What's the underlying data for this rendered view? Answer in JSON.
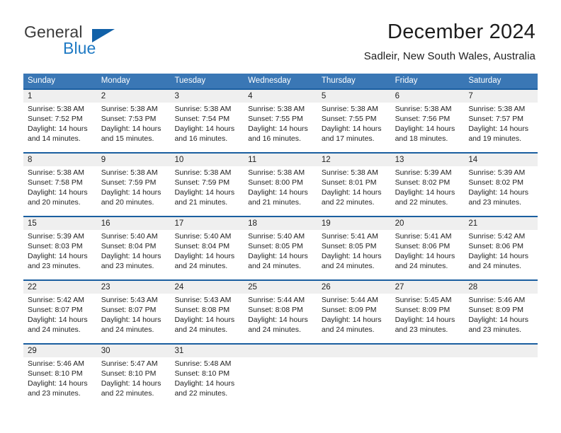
{
  "brand": {
    "name_part1": "General",
    "name_part2": "Blue",
    "triangle_icon": "triangle-icon"
  },
  "header": {
    "title": "December 2024",
    "location": "Sadleir, New South Wales, Australia"
  },
  "colors": {
    "header_blue": "#3a77b5",
    "rule_blue": "#1b5fa0",
    "band_gray": "#efefef",
    "brand_blue": "#1f7ac4",
    "brand_triangle": "#1161a8",
    "text": "#222222"
  },
  "weekdays": [
    "Sunday",
    "Monday",
    "Tuesday",
    "Wednesday",
    "Thursday",
    "Friday",
    "Saturday"
  ],
  "weeks": [
    [
      {
        "day": "1",
        "sunrise": "Sunrise: 5:38 AM",
        "sunset": "Sunset: 7:52 PM",
        "daylight1": "Daylight: 14 hours",
        "daylight2": "and 14 minutes."
      },
      {
        "day": "2",
        "sunrise": "Sunrise: 5:38 AM",
        "sunset": "Sunset: 7:53 PM",
        "daylight1": "Daylight: 14 hours",
        "daylight2": "and 15 minutes."
      },
      {
        "day": "3",
        "sunrise": "Sunrise: 5:38 AM",
        "sunset": "Sunset: 7:54 PM",
        "daylight1": "Daylight: 14 hours",
        "daylight2": "and 16 minutes."
      },
      {
        "day": "4",
        "sunrise": "Sunrise: 5:38 AM",
        "sunset": "Sunset: 7:55 PM",
        "daylight1": "Daylight: 14 hours",
        "daylight2": "and 16 minutes."
      },
      {
        "day": "5",
        "sunrise": "Sunrise: 5:38 AM",
        "sunset": "Sunset: 7:55 PM",
        "daylight1": "Daylight: 14 hours",
        "daylight2": "and 17 minutes."
      },
      {
        "day": "6",
        "sunrise": "Sunrise: 5:38 AM",
        "sunset": "Sunset: 7:56 PM",
        "daylight1": "Daylight: 14 hours",
        "daylight2": "and 18 minutes."
      },
      {
        "day": "7",
        "sunrise": "Sunrise: 5:38 AM",
        "sunset": "Sunset: 7:57 PM",
        "daylight1": "Daylight: 14 hours",
        "daylight2": "and 19 minutes."
      }
    ],
    [
      {
        "day": "8",
        "sunrise": "Sunrise: 5:38 AM",
        "sunset": "Sunset: 7:58 PM",
        "daylight1": "Daylight: 14 hours",
        "daylight2": "and 20 minutes."
      },
      {
        "day": "9",
        "sunrise": "Sunrise: 5:38 AM",
        "sunset": "Sunset: 7:59 PM",
        "daylight1": "Daylight: 14 hours",
        "daylight2": "and 20 minutes."
      },
      {
        "day": "10",
        "sunrise": "Sunrise: 5:38 AM",
        "sunset": "Sunset: 7:59 PM",
        "daylight1": "Daylight: 14 hours",
        "daylight2": "and 21 minutes."
      },
      {
        "day": "11",
        "sunrise": "Sunrise: 5:38 AM",
        "sunset": "Sunset: 8:00 PM",
        "daylight1": "Daylight: 14 hours",
        "daylight2": "and 21 minutes."
      },
      {
        "day": "12",
        "sunrise": "Sunrise: 5:38 AM",
        "sunset": "Sunset: 8:01 PM",
        "daylight1": "Daylight: 14 hours",
        "daylight2": "and 22 minutes."
      },
      {
        "day": "13",
        "sunrise": "Sunrise: 5:39 AM",
        "sunset": "Sunset: 8:02 PM",
        "daylight1": "Daylight: 14 hours",
        "daylight2": "and 22 minutes."
      },
      {
        "day": "14",
        "sunrise": "Sunrise: 5:39 AM",
        "sunset": "Sunset: 8:02 PM",
        "daylight1": "Daylight: 14 hours",
        "daylight2": "and 23 minutes."
      }
    ],
    [
      {
        "day": "15",
        "sunrise": "Sunrise: 5:39 AM",
        "sunset": "Sunset: 8:03 PM",
        "daylight1": "Daylight: 14 hours",
        "daylight2": "and 23 minutes."
      },
      {
        "day": "16",
        "sunrise": "Sunrise: 5:40 AM",
        "sunset": "Sunset: 8:04 PM",
        "daylight1": "Daylight: 14 hours",
        "daylight2": "and 23 minutes."
      },
      {
        "day": "17",
        "sunrise": "Sunrise: 5:40 AM",
        "sunset": "Sunset: 8:04 PM",
        "daylight1": "Daylight: 14 hours",
        "daylight2": "and 24 minutes."
      },
      {
        "day": "18",
        "sunrise": "Sunrise: 5:40 AM",
        "sunset": "Sunset: 8:05 PM",
        "daylight1": "Daylight: 14 hours",
        "daylight2": "and 24 minutes."
      },
      {
        "day": "19",
        "sunrise": "Sunrise: 5:41 AM",
        "sunset": "Sunset: 8:05 PM",
        "daylight1": "Daylight: 14 hours",
        "daylight2": "and 24 minutes."
      },
      {
        "day": "20",
        "sunrise": "Sunrise: 5:41 AM",
        "sunset": "Sunset: 8:06 PM",
        "daylight1": "Daylight: 14 hours",
        "daylight2": "and 24 minutes."
      },
      {
        "day": "21",
        "sunrise": "Sunrise: 5:42 AM",
        "sunset": "Sunset: 8:06 PM",
        "daylight1": "Daylight: 14 hours",
        "daylight2": "and 24 minutes."
      }
    ],
    [
      {
        "day": "22",
        "sunrise": "Sunrise: 5:42 AM",
        "sunset": "Sunset: 8:07 PM",
        "daylight1": "Daylight: 14 hours",
        "daylight2": "and 24 minutes."
      },
      {
        "day": "23",
        "sunrise": "Sunrise: 5:43 AM",
        "sunset": "Sunset: 8:07 PM",
        "daylight1": "Daylight: 14 hours",
        "daylight2": "and 24 minutes."
      },
      {
        "day": "24",
        "sunrise": "Sunrise: 5:43 AM",
        "sunset": "Sunset: 8:08 PM",
        "daylight1": "Daylight: 14 hours",
        "daylight2": "and 24 minutes."
      },
      {
        "day": "25",
        "sunrise": "Sunrise: 5:44 AM",
        "sunset": "Sunset: 8:08 PM",
        "daylight1": "Daylight: 14 hours",
        "daylight2": "and 24 minutes."
      },
      {
        "day": "26",
        "sunrise": "Sunrise: 5:44 AM",
        "sunset": "Sunset: 8:09 PM",
        "daylight1": "Daylight: 14 hours",
        "daylight2": "and 24 minutes."
      },
      {
        "day": "27",
        "sunrise": "Sunrise: 5:45 AM",
        "sunset": "Sunset: 8:09 PM",
        "daylight1": "Daylight: 14 hours",
        "daylight2": "and 23 minutes."
      },
      {
        "day": "28",
        "sunrise": "Sunrise: 5:46 AM",
        "sunset": "Sunset: 8:09 PM",
        "daylight1": "Daylight: 14 hours",
        "daylight2": "and 23 minutes."
      }
    ],
    [
      {
        "day": "29",
        "sunrise": "Sunrise: 5:46 AM",
        "sunset": "Sunset: 8:10 PM",
        "daylight1": "Daylight: 14 hours",
        "daylight2": "and 23 minutes."
      },
      {
        "day": "30",
        "sunrise": "Sunrise: 5:47 AM",
        "sunset": "Sunset: 8:10 PM",
        "daylight1": "Daylight: 14 hours",
        "daylight2": "and 22 minutes."
      },
      {
        "day": "31",
        "sunrise": "Sunrise: 5:48 AM",
        "sunset": "Sunset: 8:10 PM",
        "daylight1": "Daylight: 14 hours",
        "daylight2": "and 22 minutes."
      },
      {
        "day": "",
        "sunrise": "",
        "sunset": "",
        "daylight1": "",
        "daylight2": ""
      },
      {
        "day": "",
        "sunrise": "",
        "sunset": "",
        "daylight1": "",
        "daylight2": ""
      },
      {
        "day": "",
        "sunrise": "",
        "sunset": "",
        "daylight1": "",
        "daylight2": ""
      },
      {
        "day": "",
        "sunrise": "",
        "sunset": "",
        "daylight1": "",
        "daylight2": ""
      }
    ]
  ]
}
